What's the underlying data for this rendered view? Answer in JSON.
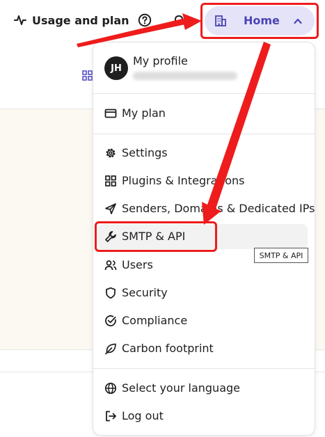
{
  "topbar": {
    "usage_label": "Usage and plan",
    "home_label": "Home"
  },
  "menu": {
    "avatar_initials": "JH",
    "profile_title": "My profile",
    "items": [
      {
        "label": "My plan",
        "icon": "credit-card-icon"
      },
      {
        "label": "Settings",
        "icon": "gear-icon"
      },
      {
        "label": "Plugins & Integrations",
        "icon": "grid-icon"
      },
      {
        "label": "Senders, Domains & Dedicated IPs",
        "icon": "send-icon"
      },
      {
        "label": "SMTP & API",
        "icon": "wrench-icon"
      },
      {
        "label": "Users",
        "icon": "users-icon"
      },
      {
        "label": "Security",
        "icon": "shield-icon"
      },
      {
        "label": "Compliance",
        "icon": "check-circle-icon"
      },
      {
        "label": "Carbon footprint",
        "icon": "leaf-icon"
      },
      {
        "label": "Select your language",
        "icon": "globe-icon"
      },
      {
        "label": "Log out",
        "icon": "logout-icon"
      }
    ]
  },
  "tooltip": {
    "text": "SMTP & API"
  },
  "colors": {
    "accent": "#4b44b3",
    "accent_bg": "#e5e3f8",
    "annotation": "#ee1c1c"
  }
}
